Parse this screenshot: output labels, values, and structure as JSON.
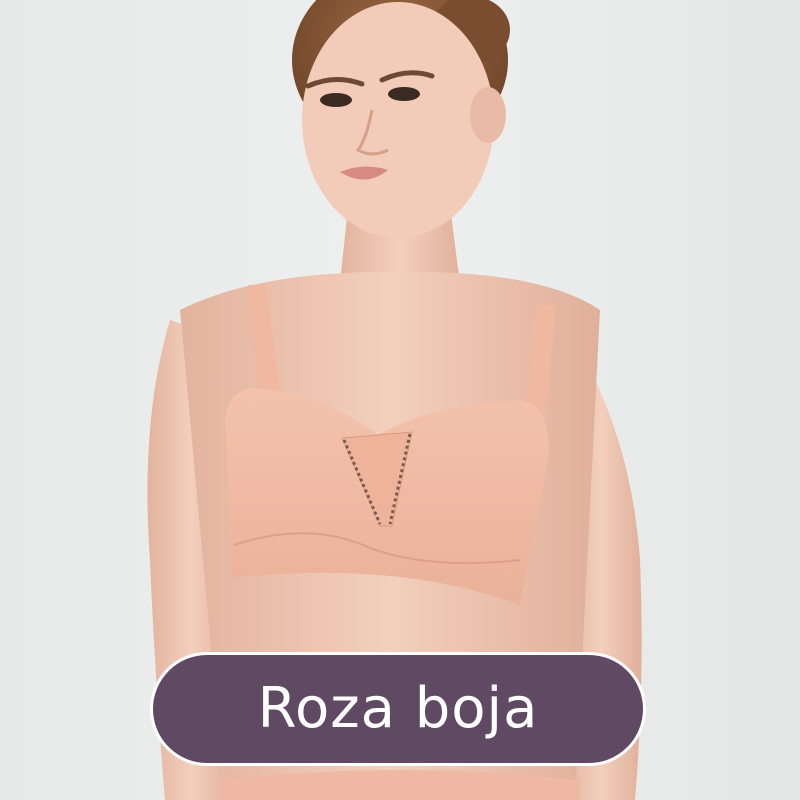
{
  "label": {
    "text": "Roza boja"
  },
  "colors": {
    "background": "#e9eceb",
    "skin": "#efc7b2",
    "bra": "#f0b8a1",
    "hair": "#8a5a3a",
    "label_fill": "#604a63",
    "label_border": "#ffffff",
    "label_text": "#ffffff"
  }
}
